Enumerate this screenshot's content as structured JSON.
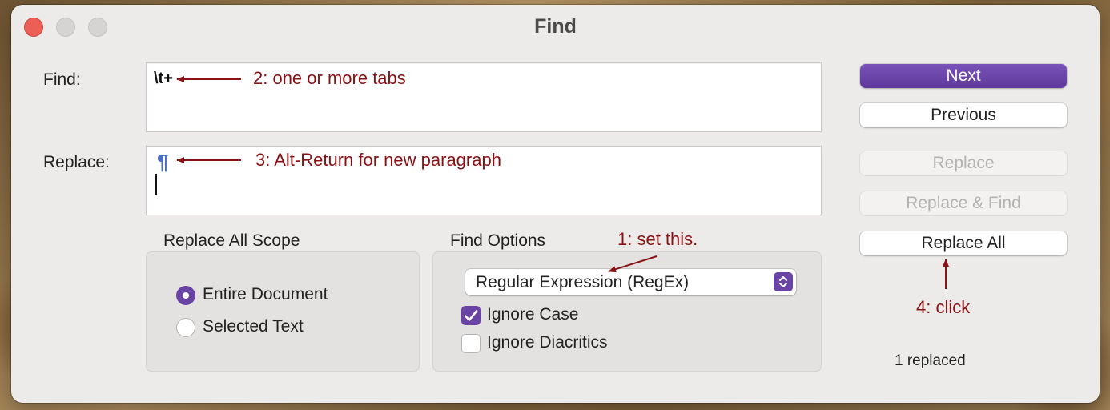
{
  "window": {
    "title": "Find"
  },
  "find": {
    "label": "Find:",
    "value": "\\t+"
  },
  "replace": {
    "label": "Replace:",
    "value": "¶"
  },
  "annotations": {
    "one": "1: set this.",
    "two": "2: one or more tabs",
    "three": "3: Alt-Return for new paragraph",
    "four": "4: click",
    "color": "#8b1214"
  },
  "scope": {
    "title": "Replace All Scope",
    "options": [
      {
        "label": "Entire Document",
        "selected": true
      },
      {
        "label": "Selected Text",
        "selected": false
      }
    ]
  },
  "find_options": {
    "title": "Find Options",
    "mode": "Regular Expression (RegEx)",
    "ignore_case": {
      "label": "Ignore Case",
      "checked": true
    },
    "ignore_diacritics": {
      "label": "Ignore Diacritics",
      "checked": false
    }
  },
  "buttons": {
    "next": "Next",
    "previous": "Previous",
    "replace": "Replace",
    "replace_find": "Replace & Find",
    "replace_all": "Replace All"
  },
  "status": "1 replaced",
  "colors": {
    "accent": "#6a44a4",
    "close": "#ec5f57"
  }
}
